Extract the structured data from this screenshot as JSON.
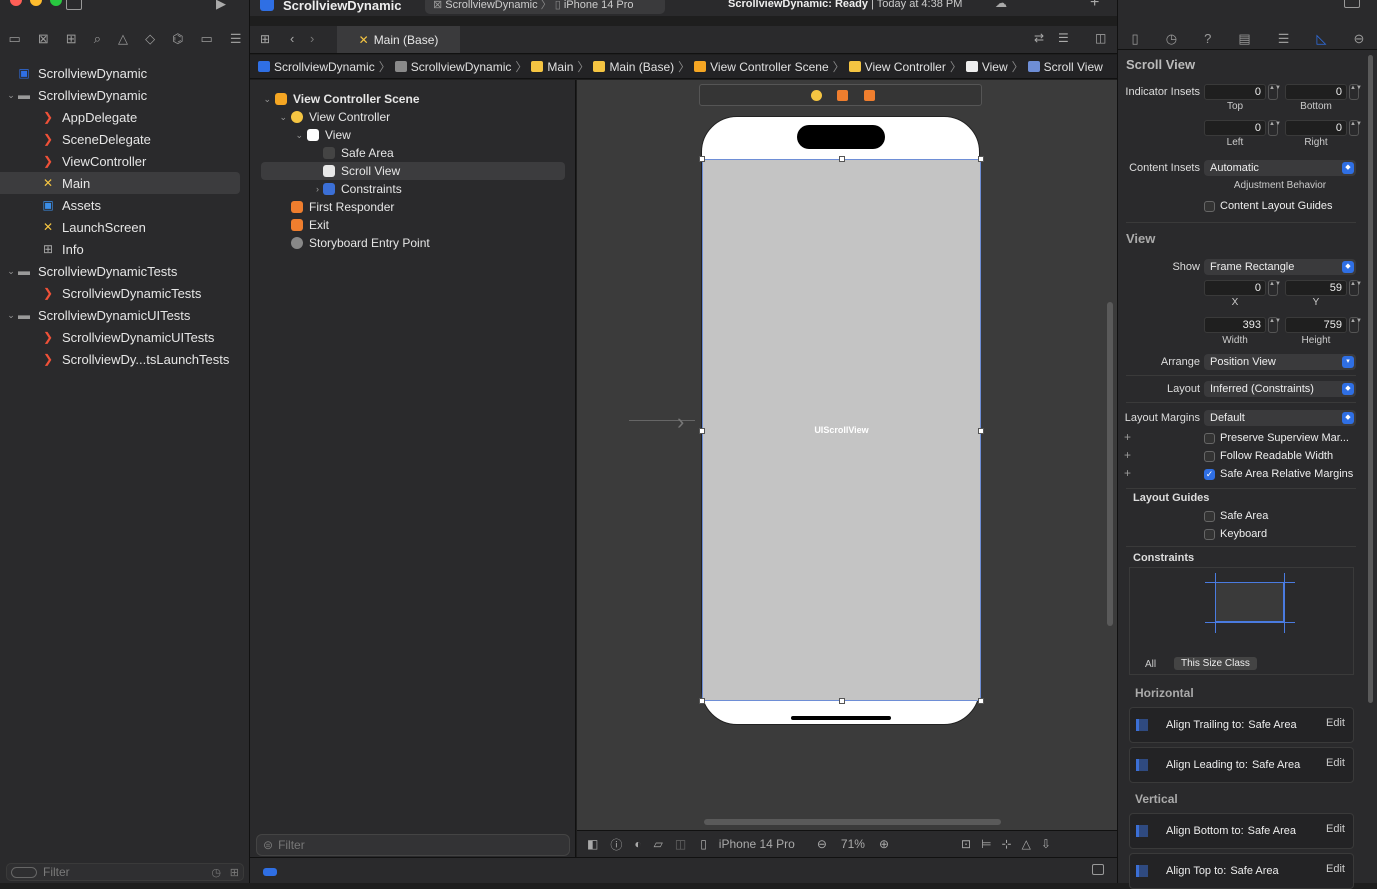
{
  "app": {
    "project": "ScrollviewDynamic",
    "scheme": "ScrollviewDynamic",
    "device": "iPhone 14 Pro",
    "status_bold": "ScrollviewDynamic: Ready",
    "status_rest": "| Today at 4:38 PM"
  },
  "navigator": {
    "items": [
      {
        "label": "ScrollviewDynamic",
        "icon": "project-icon",
        "level": 0,
        "disclosure": ""
      },
      {
        "label": "ScrollviewDynamic",
        "icon": "folder-icon",
        "level": 0,
        "disclosure": "v"
      },
      {
        "label": "AppDelegate",
        "icon": "swift-icon",
        "level": 2,
        "disclosure": ""
      },
      {
        "label": "SceneDelegate",
        "icon": "swift-icon",
        "level": 2,
        "disclosure": ""
      },
      {
        "label": "ViewController",
        "icon": "swift-icon",
        "level": 2,
        "disclosure": ""
      },
      {
        "label": "Main",
        "icon": "storyboard-icon",
        "level": 2,
        "disclosure": ""
      },
      {
        "label": "Assets",
        "icon": "assets-icon",
        "level": 2,
        "disclosure": ""
      },
      {
        "label": "LaunchScreen",
        "icon": "storyboard-icon",
        "level": 2,
        "disclosure": ""
      },
      {
        "label": "Info",
        "icon": "plist-icon",
        "level": 2,
        "disclosure": ""
      },
      {
        "label": "ScrollviewDynamicTests",
        "icon": "folder-icon",
        "level": 0,
        "disclosure": "v"
      },
      {
        "label": "ScrollviewDynamicTests",
        "icon": "swift-icon",
        "level": 2,
        "disclosure": ""
      },
      {
        "label": "ScrollviewDynamicUITests",
        "icon": "folder-icon",
        "level": 0,
        "disclosure": "v"
      },
      {
        "label": "ScrollviewDynamicUITests",
        "icon": "swift-icon",
        "level": 2,
        "disclosure": ""
      },
      {
        "label": "ScrollviewDy...tsLaunchTests",
        "icon": "swift-icon",
        "level": 2,
        "disclosure": ""
      }
    ],
    "selected_index": 5,
    "filter_placeholder": "Filter"
  },
  "editor": {
    "tab_label": "Main (Base)",
    "breadcrumb": [
      "ScrollviewDynamic",
      "ScrollviewDynamic",
      "Main",
      "Main (Base)",
      "View Controller Scene",
      "View Controller",
      "View",
      "Scroll View"
    ],
    "outline": [
      {
        "label": "View Controller Scene",
        "level": 0,
        "disclosure": "v",
        "icon": "scene-icon",
        "bold": true
      },
      {
        "label": "View Controller",
        "level": 1,
        "disclosure": "v",
        "icon": "viewcontroller-icon",
        "bold": false
      },
      {
        "label": "View",
        "level": 2,
        "disclosure": "v",
        "icon": "view-icon",
        "bold": false
      },
      {
        "label": "Safe Area",
        "level": 3,
        "disclosure": "",
        "icon": "safearea-icon",
        "bold": false
      },
      {
        "label": "Scroll View",
        "level": 3,
        "disclosure": "",
        "icon": "scrollview-icon",
        "bold": false
      },
      {
        "label": "Constraints",
        "level": 3,
        "disclosure": ">",
        "icon": "constraints-icon",
        "bold": false
      },
      {
        "label": "First Responder",
        "level": 1,
        "disclosure": "",
        "icon": "firstresponder-icon",
        "bold": false
      },
      {
        "label": "Exit",
        "level": 1,
        "disclosure": "",
        "icon": "exit-icon",
        "bold": false
      },
      {
        "label": "Storyboard Entry Point",
        "level": 1,
        "disclosure": "",
        "icon": "entrypoint-icon",
        "bold": false
      }
    ],
    "outline_selected": 4,
    "outline_filter_placeholder": "Filter",
    "canvas_label": "UIScrollView",
    "bottom_device": "iPhone 14 Pro",
    "zoom": "71%"
  },
  "inspector": {
    "title": "Scroll View",
    "indicator_insets_label": "Indicator Insets",
    "top": "0",
    "bottom": "0",
    "left": "0",
    "right": "0",
    "top_label": "Top",
    "bottom_label": "Bottom",
    "left_label": "Left",
    "right_label": "Right",
    "content_insets_label": "Content Insets",
    "content_insets_value": "Automatic",
    "adjustment_behavior": "Adjustment Behavior",
    "content_layout_guides": "Content Layout Guides",
    "view_title": "View",
    "show_label": "Show",
    "show_value": "Frame Rectangle",
    "x": "0",
    "y": "59",
    "x_label": "X",
    "y_label": "Y",
    "width": "393",
    "height": "759",
    "width_label": "Width",
    "height_label": "Height",
    "arrange_label": "Arrange",
    "arrange_value": "Position View",
    "layout_label": "Layout",
    "layout_value": "Inferred (Constraints)",
    "margins_label": "Layout Margins",
    "margins_value": "Default",
    "preserve": "Preserve Superview Mar...",
    "readable": "Follow Readable Width",
    "safe_margins": "Safe Area Relative Margins",
    "guides_title": "Layout Guides",
    "safe_area": "Safe Area",
    "keyboard": "Keyboard",
    "constraints_title": "Constraints",
    "seg_all": "All",
    "seg_size": "This Size Class",
    "horizontal": "Horizontal",
    "vertical": "Vertical",
    "h_constraints": [
      {
        "label": "Align Trailing to:",
        "target": "Safe Area"
      },
      {
        "label": "Align Leading to:",
        "target": "Safe Area"
      }
    ],
    "v_constraints": [
      {
        "label": "Align Bottom to:",
        "target": "Safe Area"
      },
      {
        "label": "Align Top to:",
        "target": "Safe Area"
      }
    ],
    "edit": "Edit"
  },
  "colors": {
    "accent": "#2f6fe4",
    "swift": "#f05138",
    "folder": "#9a9a9a",
    "storyboard": "#f5c542"
  }
}
